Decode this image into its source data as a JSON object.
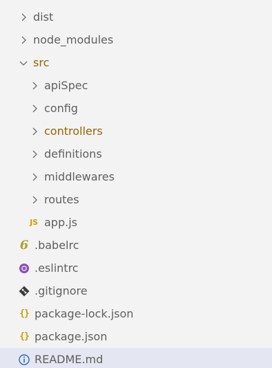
{
  "explorer": {
    "items": [
      {
        "label": "dist",
        "type": "folder",
        "expanded": false
      },
      {
        "label": "node_modules",
        "type": "folder",
        "expanded": false
      },
      {
        "label": "src",
        "type": "folder",
        "expanded": true
      },
      {
        "label": "apiSpec",
        "type": "folder",
        "expanded": false
      },
      {
        "label": "config",
        "type": "folder",
        "expanded": false
      },
      {
        "label": "controllers",
        "type": "folder",
        "expanded": false,
        "modified": true
      },
      {
        "label": "definitions",
        "type": "folder",
        "expanded": false
      },
      {
        "label": "middlewares",
        "type": "folder",
        "expanded": false
      },
      {
        "label": "routes",
        "type": "folder",
        "expanded": false
      },
      {
        "label": "app.js",
        "type": "file",
        "icon": "javascript-icon",
        "icon_text": "JS"
      },
      {
        "label": ".babelrc",
        "type": "file",
        "icon": "babel-icon",
        "icon_text": "6"
      },
      {
        "label": ".eslintrc",
        "type": "file",
        "icon": "eslint-icon"
      },
      {
        "label": ".gitignore",
        "type": "file",
        "icon": "git-icon"
      },
      {
        "label": "package-lock.json",
        "type": "file",
        "icon": "json-icon",
        "icon_text": "{}"
      },
      {
        "label": "package.json",
        "type": "file",
        "icon": "json-icon",
        "icon_text": "{}"
      },
      {
        "label": "README.md",
        "type": "file",
        "icon": "info-icon",
        "selected": true
      }
    ]
  },
  "colors": {
    "background": "#f3f3f3",
    "selected_row": "#e4e6f1",
    "text": "#5f5f5f",
    "modified_text": "#946500",
    "javascript_icon": "#c8a100",
    "babel_icon": "#b2a02a",
    "eslint_icon": "#8a4fb0",
    "git_icon": "#3c3c3c",
    "json_icon": "#c8a100",
    "info_icon": "#1f6fb5"
  }
}
